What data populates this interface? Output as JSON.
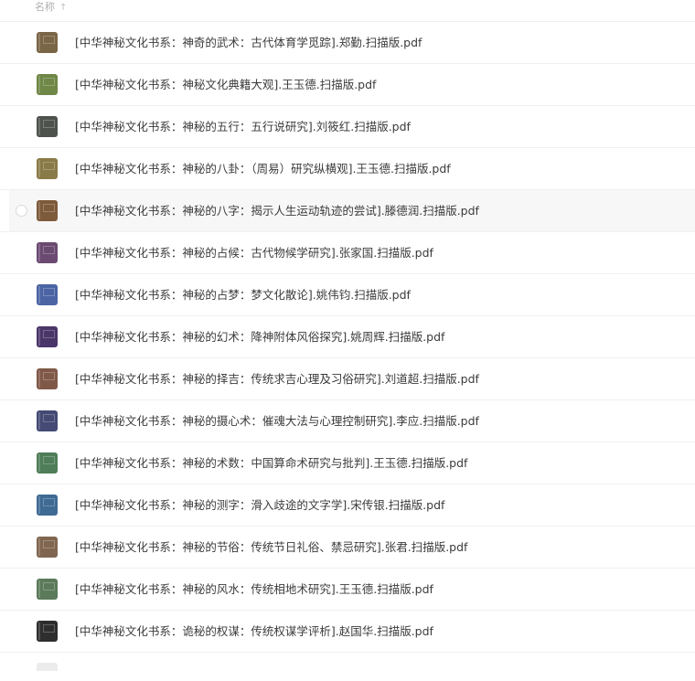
{
  "header": {
    "name_label": "名称",
    "sort_indicator": "↑"
  },
  "files": [
    {
      "name": "[中华神秘文化书系：神奇的武术：古代体育学觅踪].郑勤.扫描版.pdf",
      "color": "#7a6546",
      "hovered": false
    },
    {
      "name": "[中华神秘文化书系：神秘文化典籍大观].王玉德.扫描版.pdf",
      "color": "#6f8747",
      "hovered": false
    },
    {
      "name": "[中华神秘文化书系：神秘的五行：五行说研究].刘筱红.扫描版.pdf",
      "color": "#4d524c",
      "hovered": false
    },
    {
      "name": "[中华神秘文化书系：神秘的八卦：（周易）研究纵横观].王玉德.扫描版.pdf",
      "color": "#8a7a47",
      "hovered": false
    },
    {
      "name": "[中华神秘文化书系：神秘的八字：揭示人生运动轨迹的尝试].滕德润.扫描版.pdf",
      "color": "#7d5a3a",
      "hovered": true
    },
    {
      "name": "[中华神秘文化书系：神秘的占候：古代物候学研究].张家国.扫描版.pdf",
      "color": "#6b4a72",
      "hovered": false
    },
    {
      "name": "[中华神秘文化书系：神秘的占梦：梦文化散论].姚伟钧.扫描版.pdf",
      "color": "#4b64a3",
      "hovered": false
    },
    {
      "name": "[中华神秘文化书系：神秘的幻术：降神附体风俗探究].姚周辉.扫描版.pdf",
      "color": "#4b3669",
      "hovered": false
    },
    {
      "name": "[中华神秘文化书系：神秘的择吉：传统求吉心理及习俗研究].刘道超.扫描版.pdf",
      "color": "#805848",
      "hovered": false
    },
    {
      "name": "[中华神秘文化书系：神秘的摄心术：催魂大法与心理控制研究].李应.扫描版.pdf",
      "color": "#444a74",
      "hovered": false
    },
    {
      "name": "[中华神秘文化书系：神秘的术数：中国算命术研究与批判].王玉德.扫描版.pdf",
      "color": "#4e7d58",
      "hovered": false
    },
    {
      "name": "[中华神秘文化书系：神秘的测字：滑入歧途的文字学].宋传银.扫描版.pdf",
      "color": "#3f6a94",
      "hovered": false
    },
    {
      "name": "[中华神秘文化书系：神秘的节俗：传统节日礼俗、禁忌研究].张君.扫描版.pdf",
      "color": "#806650",
      "hovered": false
    },
    {
      "name": "[中华神秘文化书系：神秘的风水：传统相地术研究].王玉德.扫描版.pdf",
      "color": "#5b7a5a",
      "hovered": false
    },
    {
      "name": "[中华神秘文化书系：诡秘的权谋：传统权谋学评析].赵国华.扫描版.pdf",
      "color": "#2e2e2e",
      "hovered": false
    }
  ]
}
